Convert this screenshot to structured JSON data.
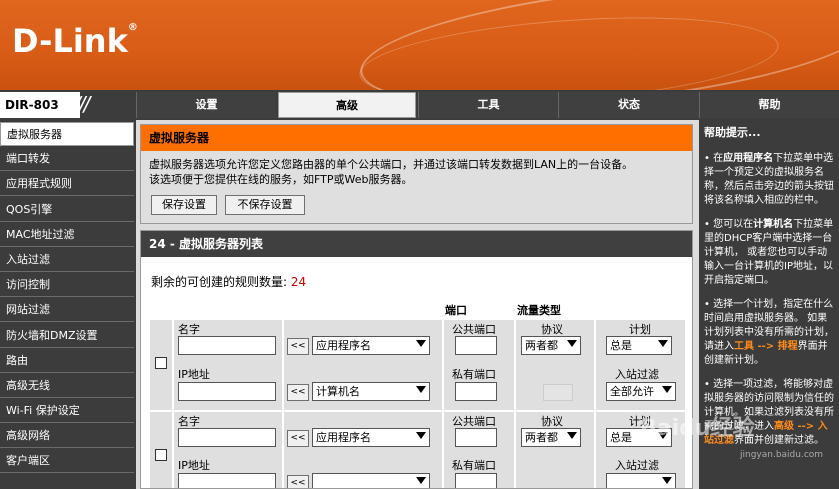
{
  "brand": {
    "logo_text": "D-Link",
    "reg_mark": "®",
    "model": "DIR-803",
    "slashes": "///"
  },
  "tabs": [
    {
      "label": "设置"
    },
    {
      "label": "高级"
    },
    {
      "label": "工具"
    },
    {
      "label": "状态"
    },
    {
      "label": "帮助"
    }
  ],
  "sidebar": {
    "items": [
      {
        "label": "虚拟服务器"
      },
      {
        "label": "端口转发"
      },
      {
        "label": "应用程式规则"
      },
      {
        "label": "QOS引擎"
      },
      {
        "label": "MAC地址过滤"
      },
      {
        "label": "入站过滤"
      },
      {
        "label": "访问控制"
      },
      {
        "label": "网站过滤"
      },
      {
        "label": "防火墙和DMZ设置"
      },
      {
        "label": "路由"
      },
      {
        "label": "高级无线"
      },
      {
        "label": "Wi-Fi 保护设定"
      },
      {
        "label": "高级网络"
      },
      {
        "label": "客户端区"
      }
    ]
  },
  "panel": {
    "title": "虚拟服务器",
    "desc_line1": "虚拟服务器选项允许您定义您路由器的单个公共端口，并通过该端口转发数据到LAN上的一台设备。",
    "desc_line2": "该选项便于您提供在线的服务，如FTP或Web服务器。",
    "save_label": "保存设置",
    "nosave_label": "不保存设置"
  },
  "list": {
    "title": "24 - 虚拟服务器列表",
    "remaining_label": "剩余的可创建的规则数量:",
    "remaining_count": "24",
    "col_port": "端口",
    "col_traffic": "流量类型",
    "rows": [
      {
        "name_label": "名字",
        "ip_label": "IP地址",
        "arrow_label": "<<",
        "app_select": "应用程序名",
        "computer_select": "计算机名",
        "public_port_label": "公共端口",
        "private_port_label": "私有端口",
        "protocol_label": "协议",
        "protocol_value": "两者都",
        "schedule_label": "计划",
        "schedule_value": "总是",
        "inbound_label": "入站过滤",
        "inbound_value": "全部允许"
      },
      {
        "name_label": "名字",
        "ip_label": "IP地址",
        "arrow_label": "<<",
        "app_select": "应用程序名",
        "computer_select": "",
        "public_port_label": "公共端口",
        "private_port_label": "私有端口",
        "protocol_label": "协议",
        "protocol_value": "两者都",
        "schedule_label": "计划",
        "schedule_value": "总是",
        "inbound_label": "入站过滤",
        "inbound_value": ""
      }
    ]
  },
  "help": {
    "title": "帮助提示...",
    "tip1_a": "在",
    "tip1_b": "应用程序名",
    "tip1_c": "下拉菜单中选择一个预定义的虚拟服务名称，然后点击旁边的箭头按钮将该名称填入相应的栏中。",
    "tip2_a": "您可以在",
    "tip2_b": "计算机名",
    "tip2_c": "下拉菜单里的DHCP客户端中选择一台计算机， 或者您也可以手动输入一台计算机的IP地址，以开启指定端口。",
    "tip3_a": "选择一个计划，指定在什么时间启用虚拟服务器。 如果计划列表中没有所需的计划，请进入",
    "tip3_link": "工具 --> 排程",
    "tip3_c": "界面并创建新计划。",
    "tip4_a": "选择一项过滤，将能够对虚拟服务器的",
    "tip4_mid": "访问限制为信任的计算机。如果过滤列表没有所需的过滤，进入",
    "tip4_link": "高级 --> 入站过滤",
    "tip4_c": "界面并创建新过滤。"
  },
  "watermark": {
    "text": "Baidu经验",
    "sub": "jingyan.baidu.com"
  }
}
